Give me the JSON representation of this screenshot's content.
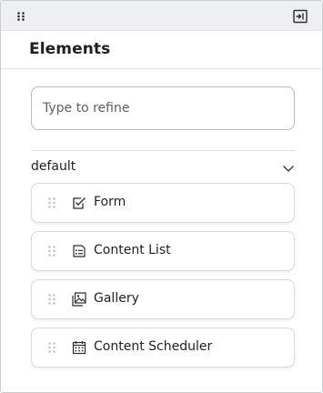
{
  "panel": {
    "title": "Elements",
    "collapse_tooltip": "Collapse panel"
  },
  "search": {
    "placeholder": "Type to refine",
    "value": ""
  },
  "group": {
    "label": "default",
    "expanded": true
  },
  "items": [
    {
      "label": "Form",
      "icon": "form-checkbox-icon"
    },
    {
      "label": "Content List",
      "icon": "content-list-icon"
    },
    {
      "label": "Gallery",
      "icon": "gallery-icon"
    },
    {
      "label": "Content Scheduler",
      "icon": "calendar-icon"
    }
  ],
  "colors": {
    "topbar_bg": "#eeeff1",
    "border": "#c9ccd1",
    "text": "#1f1f24",
    "muted_text": "#5d6168",
    "icon": "#2a2c33",
    "grip": "#b9bcc2"
  }
}
